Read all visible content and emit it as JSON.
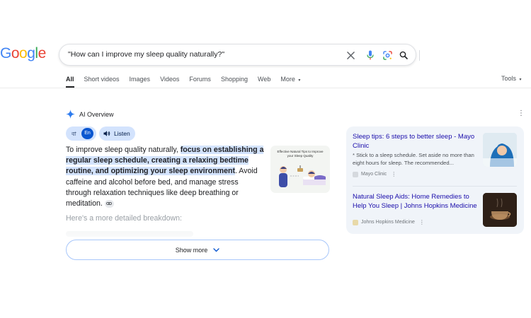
{
  "logo": {
    "letters": [
      "G",
      "o",
      "o",
      "g",
      "l",
      "e"
    ],
    "colors": [
      "#4285F4",
      "#EA4335",
      "#FBBC05",
      "#4285F4",
      "#34A853",
      "#EA4335"
    ]
  },
  "search": {
    "query": "\"How can I improve my sleep quality naturally?\""
  },
  "tabs": [
    {
      "label": "All",
      "active": true
    },
    {
      "label": "Short videos"
    },
    {
      "label": "Images"
    },
    {
      "label": "Videos"
    },
    {
      "label": "Forums"
    },
    {
      "label": "Shopping"
    },
    {
      "label": "Web"
    },
    {
      "label": "More"
    }
  ],
  "tools_label": "Tools",
  "ai_overview": {
    "title": "AI Overview",
    "lang_bn": "বা",
    "lang_en": "En",
    "listen": "Listen",
    "text_start": "To improve sleep quality naturally, ",
    "text_highlight": "focus on establishing a regular sleep schedule, creating a relaxing bedtime routine, and optimizing your sleep environment",
    "text_end": ". Avoid caffeine and alcohol before bed, and manage stress through relaxation techniques like deep breathing or meditation.",
    "thumbnail_caption": "Effective Natural Tips to Improve your Sleep Quality",
    "detail_heading": "Here's a more detailed breakdown:",
    "show_more": "Show more"
  },
  "sources": [
    {
      "title": "Sleep tips: 6 steps to better sleep - Mayo Clinic",
      "snippet": "* Stick to a sleep schedule. Set aside no more than eight hours for sleep. The recommended...",
      "site": "Mayo Clinic"
    },
    {
      "title": "Natural Sleep Aids: Home Remedies to Help You Sleep | Johns Hopkins Medicine",
      "site": "Johns Hopkins Medicine"
    }
  ],
  "colors": {
    "accent": "#0b57d0",
    "pill": "#d3e3fd",
    "link": "#1a0dab",
    "panel": "#f0f4f9"
  }
}
